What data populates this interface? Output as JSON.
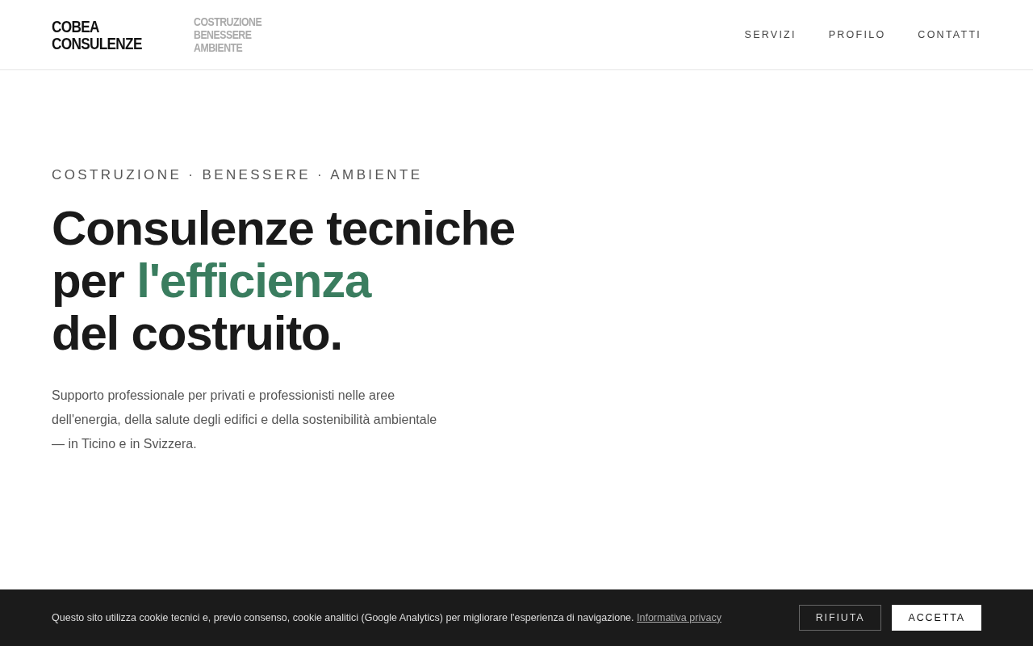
{
  "header": {
    "logo": [
      "COBEA",
      "CONSULENZE"
    ],
    "tagline": [
      "COSTRUZIONE",
      "BENESSERE",
      "AMBIENTE"
    ],
    "nav": [
      {
        "label": "SERVIZI",
        "selected": false
      },
      {
        "label": "PROFILO",
        "selected": false
      },
      {
        "label": "CONTATTI",
        "selected": false
      }
    ]
  },
  "hero": {
    "eyebrow": "COSTRUZIONE · BENESSERE · AMBIENTE",
    "headline": [
      [
        {
          "text": "Consulenze tecniche",
          "accent": false
        }
      ],
      [
        {
          "text": "per ",
          "accent": false
        },
        {
          "text": "l'efficienza",
          "accent": true
        }
      ],
      [
        {
          "text": "del costruito.",
          "accent": false
        }
      ]
    ],
    "lead": [
      "Supporto professionale per privati e professionisti nelle aree",
      "dell'energia, della salute degli edifici e della sostenibilità ambientale",
      "— in Ticino e in Svizzera."
    ]
  },
  "cookie_banner": {
    "text": "Questo sito utilizza cookie tecnici e, previo consenso, cookie analitici (Google Analytics) per migliorare l'esperienza di navigazione.",
    "link": "Informativa privacy",
    "buttons": [
      {
        "label": "RIFIUTA",
        "kind": "outline"
      },
      {
        "label": "ACCETTA",
        "kind": "solid"
      }
    ]
  }
}
